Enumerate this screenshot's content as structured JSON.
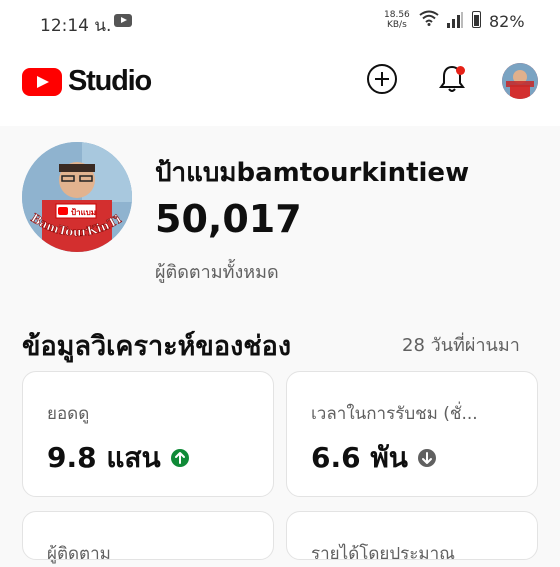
{
  "status_bar": {
    "time": "12:14 น.",
    "net_speed": "18.56",
    "net_unit": "KB/s",
    "battery": "82%"
  },
  "app_bar": {
    "logo_text": "Studio",
    "icons": [
      "youtube-play-icon",
      "create-icon",
      "notification-bell-icon",
      "account-avatar"
    ]
  },
  "channel": {
    "name": "ป้าแบมbamtourkintiew",
    "subscribers": "50,017",
    "subscribers_label": "ผู้ติดตามทั้งหมด",
    "avatar_logo": "ป้าแบม",
    "avatar_text": "BamTourKinTiew"
  },
  "analytics": {
    "title": "ข้อมูลวิเคราะห์ของช่อง",
    "period": "28 วันที่ผ่านมา",
    "cards": [
      {
        "label": "ยอดดู",
        "value": "9.8 แสน",
        "trend": "up",
        "trend_color": "#0f8a37"
      },
      {
        "label": "เวลาในการรับชม (ชั่...",
        "value": "6.6 พัน",
        "trend": "down",
        "trend_color": "#606060"
      },
      {
        "label": "ผู้ติดตาม",
        "value": ""
      },
      {
        "label": "รายได้โดยประมาณ",
        "value": ""
      }
    ]
  },
  "colors": {
    "brand_red": "#ff0000",
    "text_primary": "#0f0f0f",
    "text_secondary": "#606060",
    "background": "#f9f9f9"
  }
}
